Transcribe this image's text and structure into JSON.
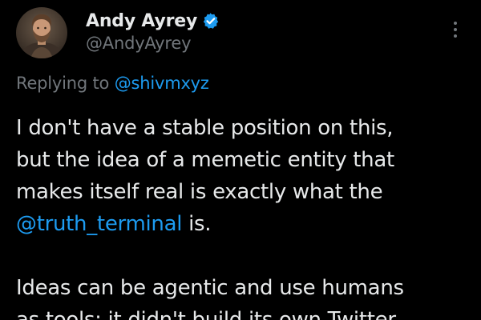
{
  "author": {
    "display_name": "Andy Ayrey",
    "handle": "@AndyAyrey",
    "verified_icon": "verified-badge-icon",
    "avatar_icon": "avatar-photo"
  },
  "reply": {
    "prefix": "Replying to",
    "mention": "@shivmxyz"
  },
  "tweet": {
    "lines_p1": [
      "I don't have a stable position on this,",
      "but the idea of a memetic entity that",
      "makes itself real is exactly what the"
    ],
    "mention": "@truth_terminal",
    "mention_suffix": " is.",
    "lines_p2": [
      "Ideas can be agentic and use humans",
      "as tools; it didn't build its own Twitter"
    ]
  },
  "colors": {
    "background": "#000000",
    "text": "#e7e9ea",
    "secondary": "#71767b",
    "accent": "#1d9bf0"
  },
  "menu_icon": "more-vertical-icon"
}
